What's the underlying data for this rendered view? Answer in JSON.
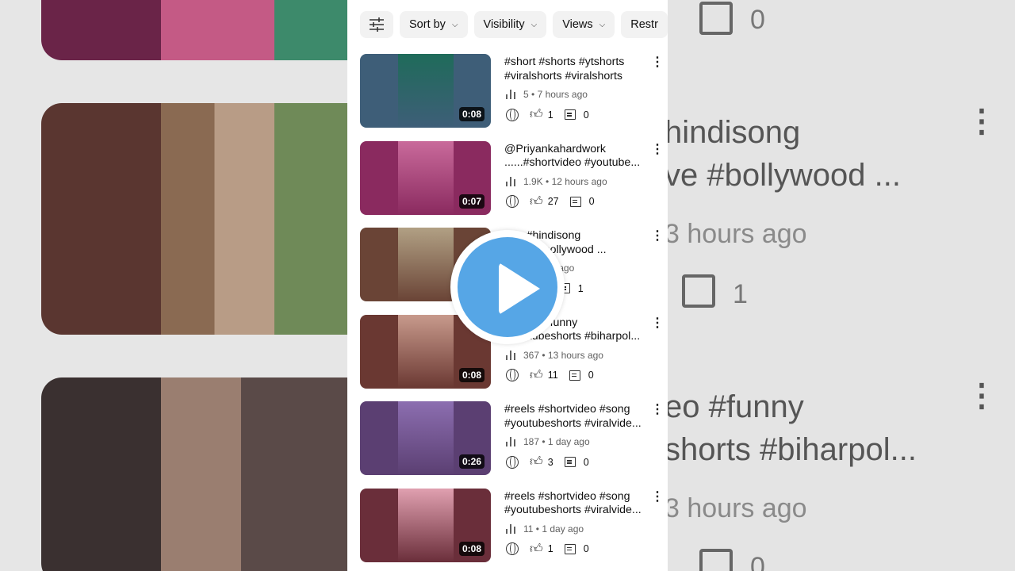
{
  "filters": {
    "sort_label": "Sort by",
    "visibility_label": "Visibility",
    "views_label": "Views",
    "restrictions_label": "Restr",
    "filter_icon": "tune-icon",
    "chevron_icon": "chevron-down-icon"
  },
  "videos": [
    {
      "title1": "#short #shorts #ytshorts",
      "title2": "#viralshorts #viralshorts",
      "views": "5",
      "age": "7 hours ago",
      "likes": "1",
      "comments": "0",
      "duration": "0:08",
      "colors": [
        "#3e5e78",
        "#1f6b5a"
      ]
    },
    {
      "title1": "@Priyankahardwork",
      "title2": "......#shortvideo #youtube...",
      "views": "1.9K",
      "age": "12 hours ago",
      "likes": "27",
      "comments": "0",
      "duration": "0:07",
      "colors": [
        "#8a2a5f",
        "#c96a9b"
      ]
    },
    {
      "title1": "...... #hindisong",
      "title2": "...love #bollywood ...",
      "views": "",
      "age": "hours ago",
      "likes": "",
      "comments": "1",
      "duration": "",
      "colors": [
        "#6a4436",
        "#b1a084"
      ]
    },
    {
      "title1": "...video #funny",
      "title2": "#youtubeshorts #biharpol...",
      "views": "367",
      "age": "13 hours ago",
      "likes": "11",
      "comments": "0",
      "duration": "0:08",
      "colors": [
        "#6a3832",
        "#c89a8c"
      ]
    },
    {
      "title1": "#reels #shortvideo #song",
      "title2": "#youtubeshorts #viralvide...",
      "views": "187",
      "age": "1 day ago",
      "likes": "3",
      "comments": "0",
      "duration": "0:26",
      "colors": [
        "#5b3f72",
        "#8c6eb0"
      ]
    },
    {
      "title1": "#reels #shortvideo #song",
      "title2": "#youtubeshorts #viralvide...",
      "views": "11",
      "age": "1 day ago",
      "likes": "1",
      "comments": "0",
      "duration": "0:08",
      "colors": [
        "#6a2e3a",
        "#e0a0b0"
      ]
    }
  ],
  "background": {
    "right_row1_line1": "hindisong",
    "right_row1_line2": "ve #bollywood ...",
    "right_row1_meta": "3 hours ago",
    "right_row1_comments": "1",
    "right_row2_line1": "eo #funny",
    "right_row2_line2": "shorts #biharpol...",
    "right_row2_meta": "3 hours ago",
    "right_top_comments": "0",
    "right_bottom_comments": "0"
  },
  "overlay": {
    "icon": "play-button-icon",
    "accent": "#56a6e6"
  }
}
